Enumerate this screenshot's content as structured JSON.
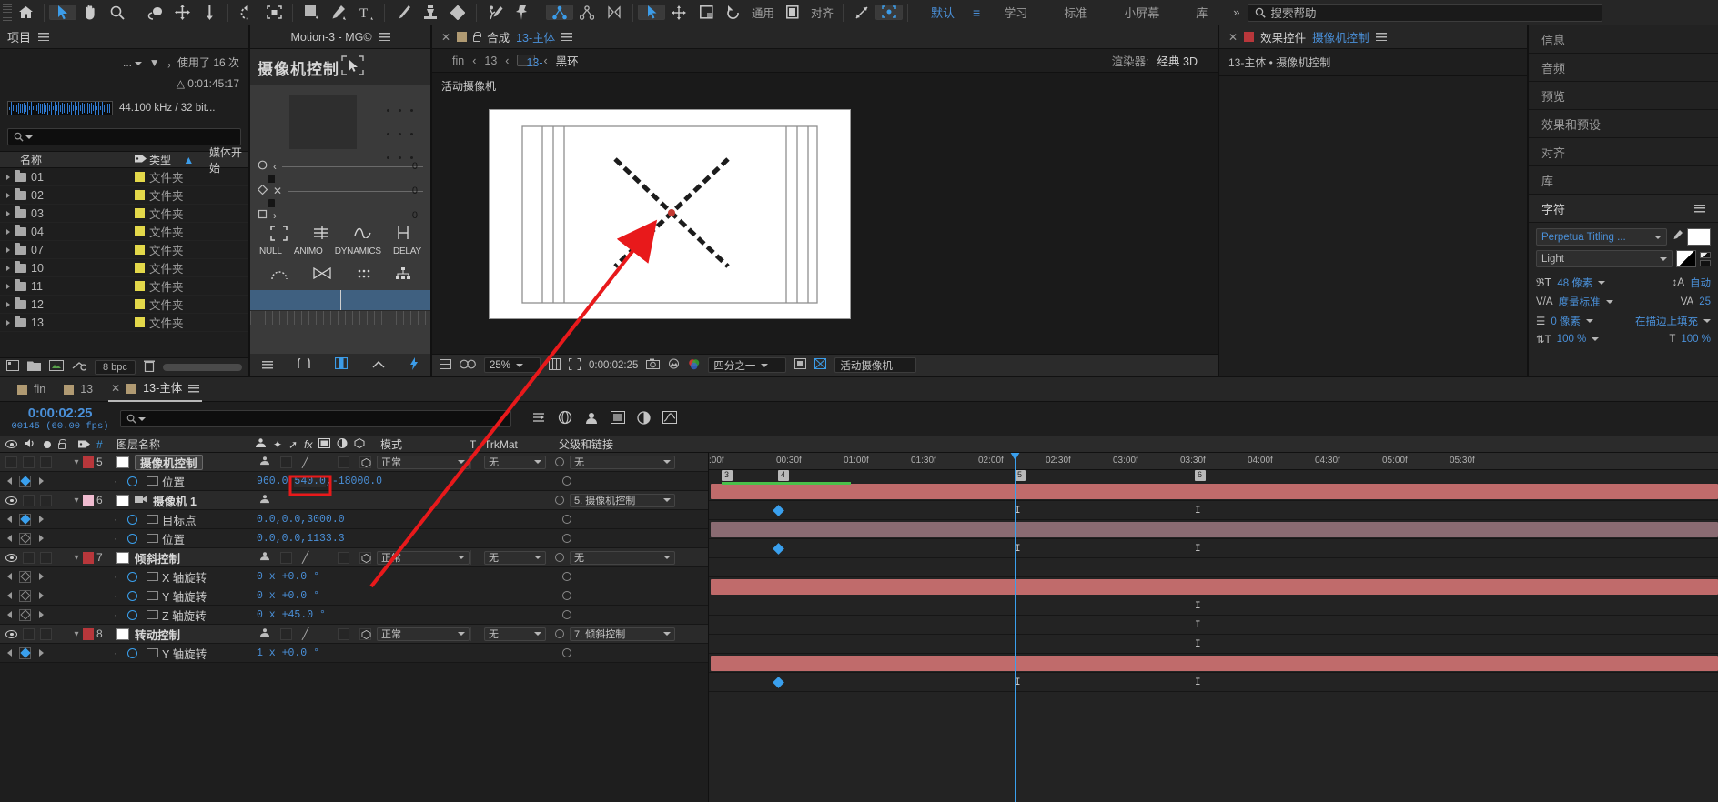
{
  "toolbar": {
    "icons": [
      "home-icon",
      "selection-tool-icon",
      "hand-tool-icon",
      "zoom-tool-icon",
      "rotation-tool-icon",
      "pan-behind-tool-icon",
      "anchor-tool-icon",
      "orbit-tool-icon",
      "region-of-interest-icon",
      "shape-tool-icon",
      "pen-tool-icon",
      "type-tool-icon",
      "brush-tool-icon",
      "clone-stamp-icon",
      "eraser-tool-icon",
      "roto-brush-icon",
      "puppet-pin-icon",
      "orbit-camera-icon",
      "pan-camera-icon",
      "dolly-camera-icon",
      "selection-arrow-icon",
      "move-tool-icon",
      "crop-icon",
      "rotate-ccw-icon",
      "align-box-icon",
      "path-icon",
      "region-select-icon"
    ],
    "general_label": "通用",
    "align_label": "对齐",
    "workspaces": [
      {
        "label": "默认",
        "active": true
      },
      {
        "label": "学习",
        "active": false
      },
      {
        "label": "标准",
        "active": false
      },
      {
        "label": "小屏幕",
        "active": false
      },
      {
        "label": "库",
        "active": false
      }
    ],
    "overflow_label": "»",
    "search_placeholder": "搜索帮助"
  },
  "project": {
    "title": "项目",
    "menu_icon": "hamburger-icon",
    "used_text": "，使用了",
    "used_count": "16 次",
    "dots": "...",
    "duration": "0:01:45:17",
    "audio_info": "44.100 kHz / 32 bit...",
    "search_placeholder": "",
    "columns": [
      "名称",
      "类型",
      "媒体开始"
    ],
    "sort_col": "类型",
    "rows": [
      {
        "name": "01",
        "type": "文件夹",
        "color": "#e3d84a"
      },
      {
        "name": "02",
        "type": "文件夹",
        "color": "#e3d84a"
      },
      {
        "name": "03",
        "type": "文件夹",
        "color": "#e3d84a"
      },
      {
        "name": "04",
        "type": "文件夹",
        "color": "#e3d84a"
      },
      {
        "name": "07",
        "type": "文件夹",
        "color": "#e3d84a"
      },
      {
        "name": "10",
        "type": "文件夹",
        "color": "#e3d84a"
      },
      {
        "name": "11",
        "type": "文件夹",
        "color": "#e3d84a"
      },
      {
        "name": "12",
        "type": "文件夹",
        "color": "#e3d84a"
      },
      {
        "name": "13",
        "type": "文件夹",
        "color": "#e3d84a"
      }
    ],
    "bpc": "8 bpc"
  },
  "motion": {
    "panel_title": "Motion-3 - MG©",
    "header": "摄像机控制",
    "slider_values": [
      "0",
      "0",
      "0"
    ],
    "buttons": [
      "NULL",
      "ANIMO",
      "DYNAMICS",
      "DELAY"
    ]
  },
  "comp": {
    "tab_label": "合成",
    "tab_name": "13-主体",
    "breadcrumbs": [
      "fin",
      "13",
      "13-主体",
      "黑环"
    ],
    "breadcrumb_active_index": 2,
    "view_label": "活动摄像机",
    "renderer_label": "渲染器:",
    "renderer_value": "经典 3D",
    "zoom": "25%",
    "time": "0:00:02:25",
    "resolution": "四分之一",
    "view_select": "活动摄像机"
  },
  "effects": {
    "tab_label": "效果控件",
    "tab_name": "摄像机控制",
    "subtitle": "13-主体 • 摄像机控制"
  },
  "right_panels": [
    {
      "label": "信息"
    },
    {
      "label": "音频"
    },
    {
      "label": "预览"
    },
    {
      "label": "效果和预设"
    },
    {
      "label": "对齐"
    },
    {
      "label": "库"
    }
  ],
  "character": {
    "title": "字符",
    "font_family": "Perpetua Titling ...",
    "font_style": "Light",
    "font_size": "48 像素",
    "leading": "自动",
    "tracking_label": "度量标准",
    "tracking": "25",
    "stroke_width": "0 像素",
    "stroke_mode": "在描边上填充",
    "v_scale": "100 %",
    "h_scale": "100 %"
  },
  "timeline": {
    "tabs": [
      {
        "label": "fin",
        "active": false
      },
      {
        "label": "13",
        "active": false
      },
      {
        "label": "13-主体",
        "active": true
      }
    ],
    "current_time": "0:00:02:25",
    "frame_info": "00145 (60.00 fps)",
    "search_placeholder": "",
    "columns": {
      "name": "图层名称",
      "mode": "模式",
      "t": "T",
      "trkmat": "TrkMat",
      "parent": "父级和链接",
      "num": "#"
    },
    "ruler_ticks": [
      ":00f",
      "00:30f",
      "01:00f",
      "01:30f",
      "02:00f",
      "02:30f",
      "03:00f",
      "03:30f",
      "04:00f",
      "04:30f",
      "05:00f",
      "05:30f"
    ],
    "markers": [
      "3",
      "4",
      "5",
      "6"
    ],
    "rows": [
      {
        "kind": "layer",
        "num": "5",
        "name": "摄像机控制",
        "selected": true,
        "color": "#b8373b",
        "mode": "正常",
        "trkmat": "无",
        "parent": "无",
        "bar_color": "#c06b6b",
        "visible": false
      },
      {
        "kind": "prop",
        "name": "位置",
        "value_parts": [
          "960.0,",
          "540.0",
          ",-18000.0"
        ],
        "highlight_index": 1,
        "keyframes": true
      },
      {
        "kind": "layer",
        "num": "6",
        "name": "摄像机 1",
        "selected": false,
        "color": "#f0bcd0",
        "mode": "",
        "trkmat": "",
        "parent": "5. 摄像机控制",
        "bar_color": "#8a6b72",
        "visible": true,
        "camera": true
      },
      {
        "kind": "prop",
        "name": "目标点",
        "value_parts": [
          "0.0,0.0,3000.0"
        ],
        "keyframes": true
      },
      {
        "kind": "prop",
        "name": "位置",
        "value_parts": [
          "0.0,0.0,1133.3"
        ],
        "keyframes": false
      },
      {
        "kind": "layer",
        "num": "7",
        "name": "倾斜控制",
        "selected": false,
        "color": "#b8373b",
        "mode": "正常",
        "trkmat": "无",
        "parent": "无",
        "bar_color": "#c06b6b",
        "visible": true
      },
      {
        "kind": "prop",
        "name": "X 轴旋转",
        "value_parts": [
          "0 x +0.0 °"
        ],
        "keyframes": false
      },
      {
        "kind": "prop",
        "name": "Y 轴旋转",
        "value_parts": [
          "0 x +0.0 °"
        ],
        "keyframes": false
      },
      {
        "kind": "prop",
        "name": "Z 轴旋转",
        "value_parts": [
          "0 x +45.0 °"
        ],
        "keyframes": false
      },
      {
        "kind": "layer",
        "num": "8",
        "name": "转动控制",
        "selected": false,
        "color": "#b8373b",
        "mode": "正常",
        "trkmat": "无",
        "parent": "7. 倾斜控制",
        "bar_color": "#c06b6b",
        "visible": true
      },
      {
        "kind": "prop",
        "name": "Y 轴旋转",
        "value_parts": [
          "1 x +0.0 °"
        ],
        "keyframes": true
      }
    ]
  },
  "annotation": {
    "arrow_color": "#e8191b",
    "highlight_color": "#e8191b",
    "highlight_value": "540.0"
  },
  "colors": {
    "accent_blue": "#4a90d9",
    "panel_bg": "#1e1e1e",
    "toolbar_bg": "#262626"
  }
}
